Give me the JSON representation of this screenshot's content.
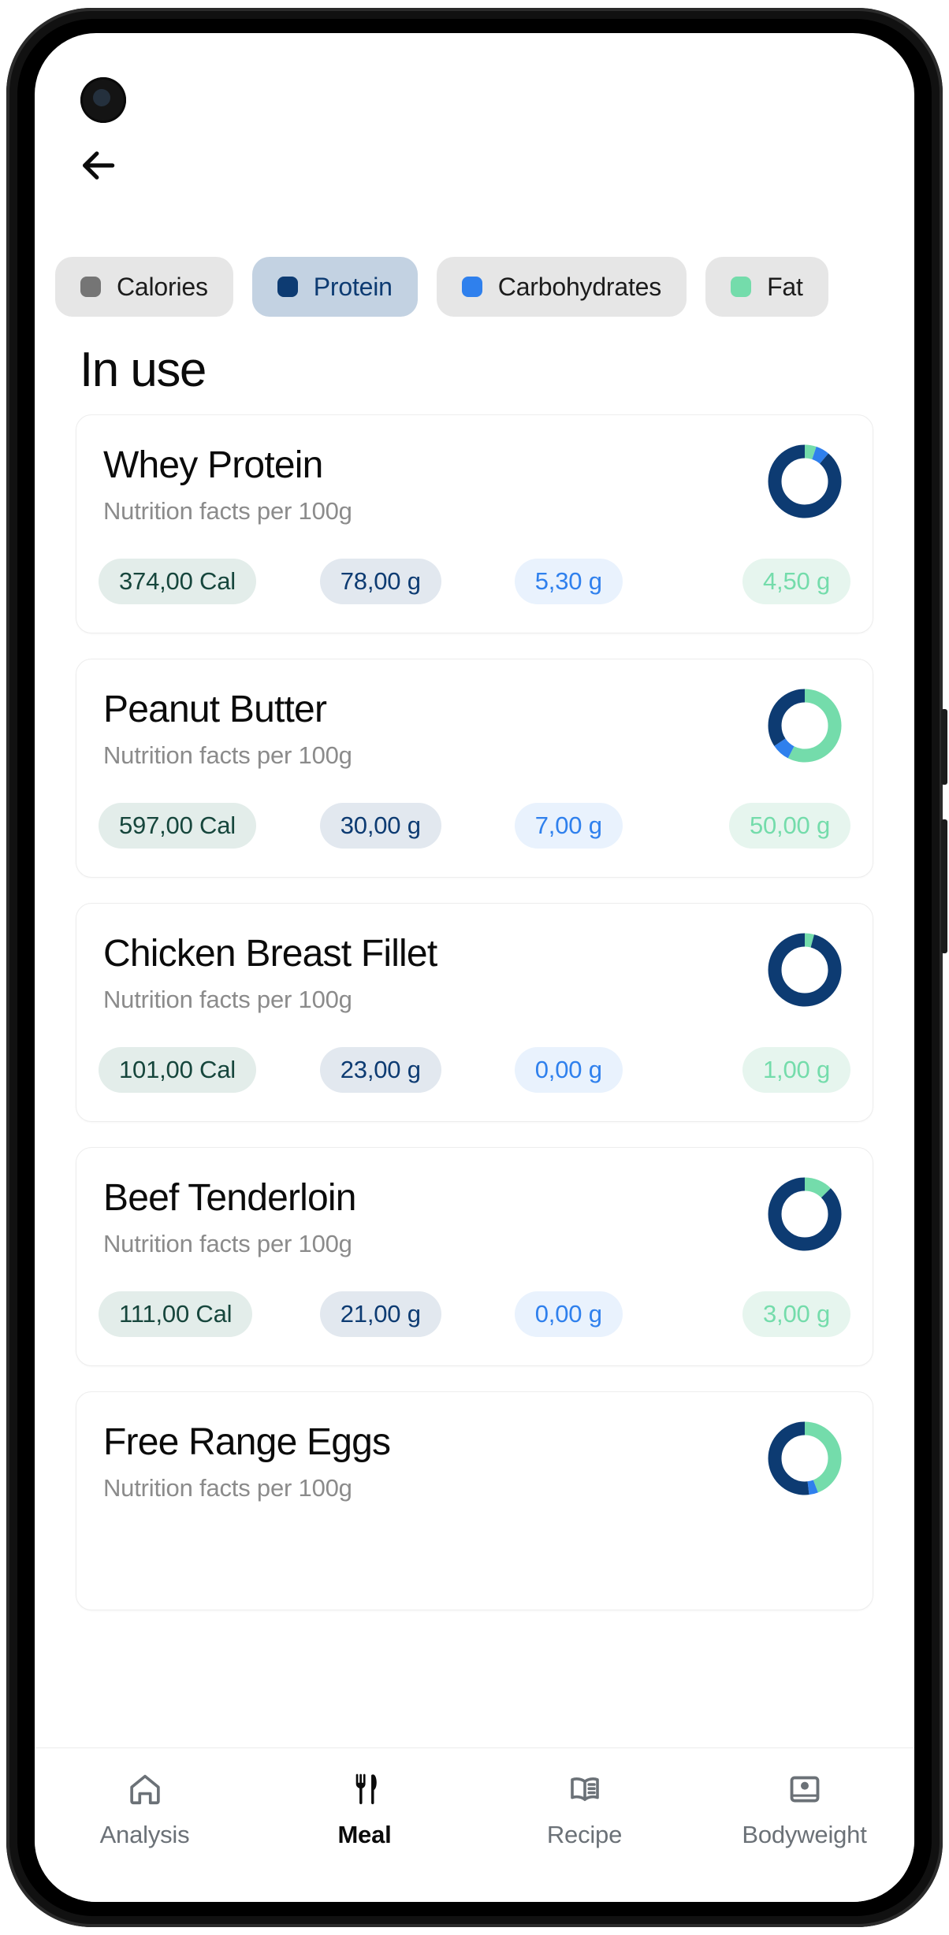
{
  "colors": {
    "protein": "#0d3b72",
    "carbs": "#2f80ed",
    "fat": "#74dcab",
    "calories": "#757575",
    "chip_selected_bg": "#c3d2e2",
    "chip_bg": "#e6e6e6"
  },
  "header": {
    "back_icon": "arrow-left-icon"
  },
  "filters": [
    {
      "label": "Calories",
      "dot_color": "#757575",
      "selected": false
    },
    {
      "label": "Protein",
      "dot_color": "#0d3b72",
      "selected": true
    },
    {
      "label": "Carbohydrates",
      "dot_color": "#2f80ed",
      "selected": false
    },
    {
      "label": "Fat",
      "dot_color": "#74dcab",
      "selected": false
    }
  ],
  "section": {
    "title": "In use"
  },
  "foods": [
    {
      "name": "Whey Protein",
      "subtitle": "Nutrition facts per 100g",
      "calories": "374,00 Cal",
      "protein": "78,00 g",
      "carbs": "5,30 g",
      "fat": "4,50 g",
      "macros": {
        "protein": 78.0,
        "carbs": 5.3,
        "fat": 4.5
      }
    },
    {
      "name": "Peanut Butter",
      "subtitle": "Nutrition facts per 100g",
      "calories": "597,00 Cal",
      "protein": "30,00 g",
      "carbs": "7,00 g",
      "fat": "50,00 g",
      "macros": {
        "protein": 30.0,
        "carbs": 7.0,
        "fat": 50.0
      }
    },
    {
      "name": "Chicken Breast Fillet",
      "subtitle": "Nutrition facts per 100g",
      "calories": "101,00 Cal",
      "protein": "23,00 g",
      "carbs": "0,00 g",
      "fat": "1,00 g",
      "macros": {
        "protein": 23.0,
        "carbs": 0.0,
        "fat": 1.0
      }
    },
    {
      "name": "Beef Tenderloin",
      "subtitle": "Nutrition facts per 100g",
      "calories": "111,00 Cal",
      "protein": "21,00 g",
      "carbs": "0,00 g",
      "fat": "3,00 g",
      "macros": {
        "protein": 21.0,
        "carbs": 0.0,
        "fat": 3.0
      }
    },
    {
      "name": "Free Range Eggs",
      "subtitle": "Nutrition facts per 100g",
      "calories": "",
      "protein": "",
      "carbs": "",
      "fat": "",
      "macros": {
        "protein": 13.0,
        "carbs": 1.0,
        "fat": 11.0
      }
    }
  ],
  "bottom_nav": [
    {
      "label": "Analysis",
      "icon": "home-icon",
      "active": false
    },
    {
      "label": "Meal",
      "icon": "cutlery-icon",
      "active": true
    },
    {
      "label": "Recipe",
      "icon": "book-icon",
      "active": false
    },
    {
      "label": "Bodyweight",
      "icon": "scale-icon",
      "active": false
    }
  ]
}
